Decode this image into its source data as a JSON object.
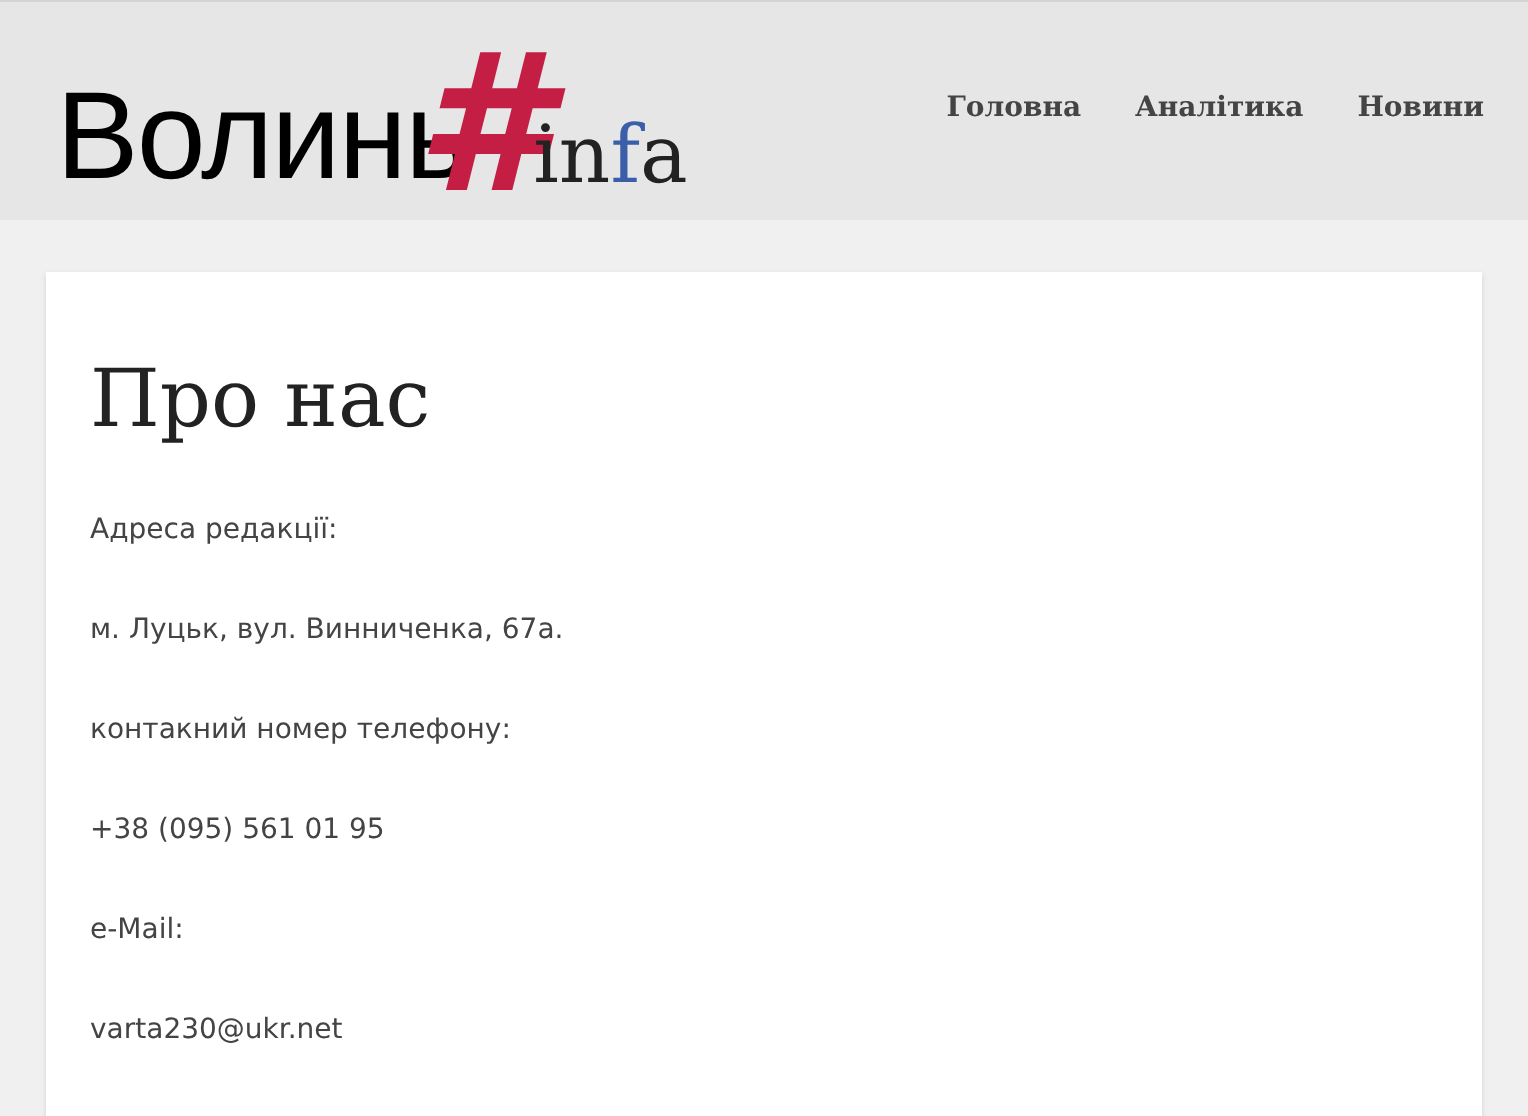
{
  "logo": [
    {
      "text": "Волинь",
      "kind": "sans"
    },
    {
      "text": "#",
      "kind": "hash"
    },
    {
      "text": "in",
      "kind": "serif"
    },
    {
      "text": "f",
      "kind": "accent"
    },
    {
      "text": "a",
      "kind": "serif"
    }
  ],
  "nav": [
    "Головна",
    "Аналітика",
    "Новини"
  ],
  "page": {
    "title": "Про нас",
    "paragraphs": [
      "Адреса редакції:",
      "м. Луцьк, вул. Винниченка, 67а.",
      "контакний номер телефону:",
      "+38 (095) 561 01 95",
      "e-Mail:",
      "varta230@ukr.net"
    ]
  }
}
